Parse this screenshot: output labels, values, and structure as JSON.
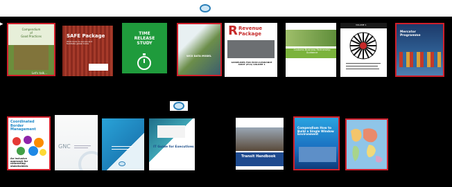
{
  "publications": [
    {
      "id": "b1",
      "lines": [
        "Compendium",
        "of",
        "Good Practices"
      ],
      "footer": "Let's talk..."
    },
    {
      "id": "b2",
      "title": "SAFE Package",
      "sub": "WCO tools to secure and facilitate global trade"
    },
    {
      "id": "b3",
      "title": "TIME RELEASE STUDY"
    },
    {
      "id": "b4",
      "title": "WCO DATA MODEL"
    },
    {
      "id": "b5",
      "title": "Revenue Package",
      "sub": "GUIDELINES FOR POST-CLEARANCE AUDIT (PCA) VOLUME 1"
    },
    {
      "id": "b6",
      "title": "Customs Business Partnership Guidance"
    },
    {
      "id": "b7",
      "title": "VOLUME 1"
    },
    {
      "id": "b8",
      "title": "Mercator Programme"
    },
    {
      "id": "b9",
      "title": "Coordinated Border Management",
      "sub": "An inclusive approach for connecting stakeholders"
    },
    {
      "id": "b10",
      "title": "GNC"
    },
    {
      "id": "b11",
      "title": ""
    },
    {
      "id": "b12",
      "title": "IT Guide for Executives"
    },
    {
      "id": "b13",
      "title": "Transit Handbook"
    },
    {
      "id": "b14",
      "title": "Compendium How to Build a Single Window Environment"
    },
    {
      "id": "b15",
      "title": ""
    }
  ],
  "colors": {
    "background": "#000000",
    "selection": "#d21f2b",
    "wco_blue": "#2a7fb8"
  },
  "icons": {
    "logo": "wco-emblem-icon",
    "arrow": "cursor-arrow-icon"
  }
}
